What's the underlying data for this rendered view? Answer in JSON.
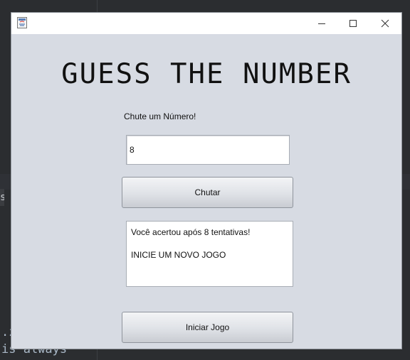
{
  "background": {
    "code_line_1": ".z",
    "code_line_2": "is always",
    "side_fragment": "s"
  },
  "window": {
    "title": "",
    "icon": "java-icon",
    "controls": {
      "minimize": "minimize-icon",
      "maximize": "maximize-icon",
      "close": "close-icon"
    }
  },
  "game": {
    "title": "GUESS THE NUMBER",
    "prompt_label": "Chute um Número!",
    "guess_value": "8",
    "guess_button": "Chutar",
    "output_line_1": "Você acertou após 8 tentativas!",
    "output_line_2": "INICIE UM NOVO JOGO",
    "start_button": "Iniciar Jogo"
  },
  "colors": {
    "window_bg": "#d7dbe3",
    "titlebar_bg": "#ffffff",
    "editor_bg": "#2b2d30"
  }
}
